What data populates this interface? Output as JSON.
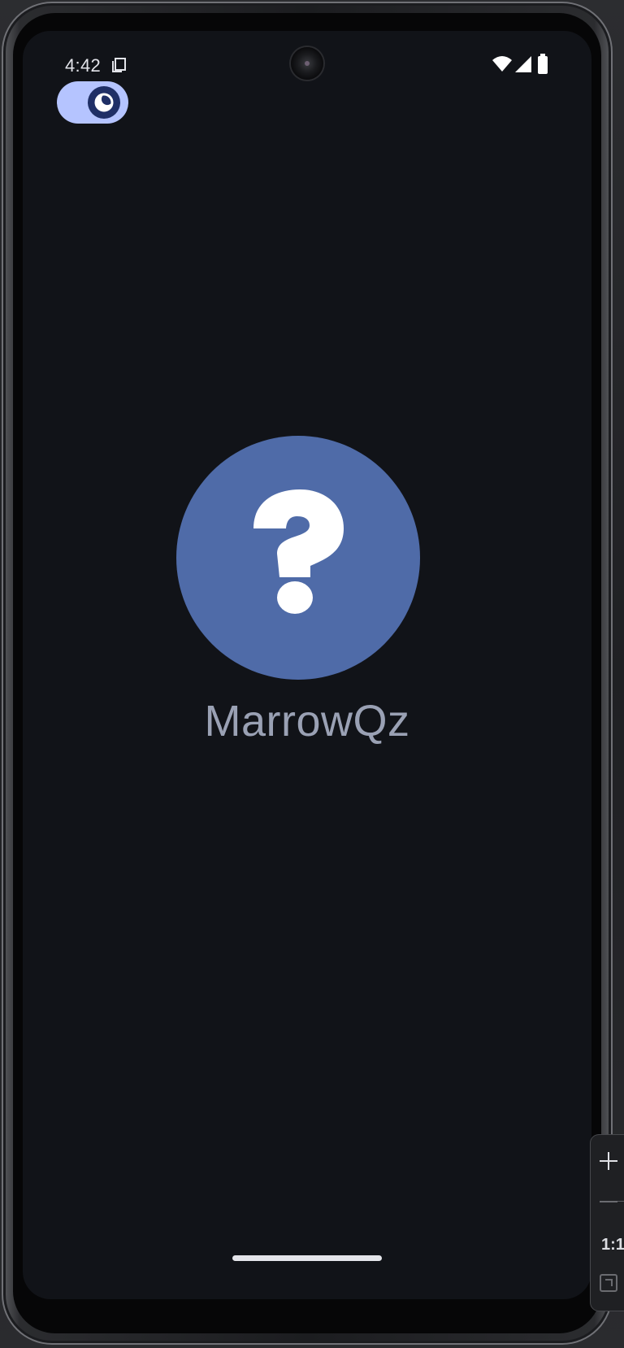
{
  "status_bar": {
    "time": "4:42",
    "icons": [
      "sim-card-icon",
      "wifi-icon",
      "signal-icon",
      "battery-icon"
    ]
  },
  "theme_toggle": {
    "icon": "moon-icon",
    "state": "dark",
    "color": "#b5c4ff"
  },
  "logo": {
    "icon": "question-mark-icon",
    "color": "#4f6ba8"
  },
  "app": {
    "name": "MarrowQz"
  },
  "emulator_toolbar": {
    "zoom_in_icon": "plus-icon",
    "zoom_out_icon": "minus-icon",
    "reset_label": "1:1",
    "fit_icon": "fit-screen-icon"
  },
  "colors": {
    "background": "#111318",
    "text_secondary": "#9aa1b4",
    "accent": "#4f6ba8"
  }
}
